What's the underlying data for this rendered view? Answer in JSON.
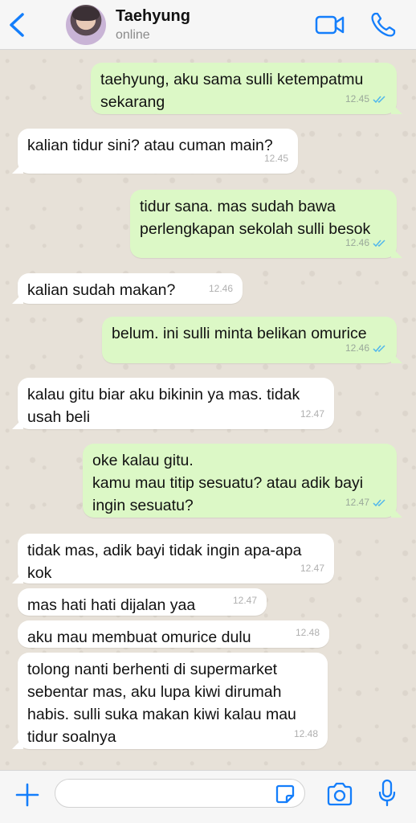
{
  "header": {
    "contact_name": "Taehyung",
    "status": "online",
    "icons": [
      "back-arrow-icon",
      "avatar",
      "video-call-icon",
      "phone-call-icon"
    ]
  },
  "messages": [
    {
      "direction": "out",
      "text": "taehyung, aku sama sulli ketempatmu\nsekarang",
      "time": "12.45",
      "read": true
    },
    {
      "direction": "in",
      "text": "kalian tidur sini? atau cuman main?",
      "time": "12.45"
    },
    {
      "direction": "out",
      "text": "tidur sana. mas sudah bawa\nperlengkapan sekolah sulli besok",
      "time": "12.46",
      "read": true
    },
    {
      "direction": "in",
      "text": "kalian sudah makan?",
      "time": "12.46"
    },
    {
      "direction": "out",
      "text": "belum. ini sulli minta belikan omurice",
      "time": "12.46",
      "read": true
    },
    {
      "direction": "in",
      "text": "kalau gitu biar aku bikinin ya mas. tidak\nusah beli",
      "time": "12.47"
    },
    {
      "direction": "out",
      "text": "oke kalau gitu.\nkamu mau titip sesuatu? atau adik bayi\ningin sesuatu?",
      "time": "12.47",
      "read": true
    },
    {
      "direction": "in",
      "text": "tidak mas, adik bayi tidak ingin apa-apa\nkok",
      "time": "12.47"
    },
    {
      "direction": "in",
      "text": "mas hati hati dijalan yaa",
      "time": "12.47"
    },
    {
      "direction": "in",
      "text": "aku mau membuat omurice dulu",
      "time": "12.48"
    },
    {
      "direction": "in",
      "text": "tolong nanti berhenti di supermarket\nsebentar mas, aku lupa kiwi dirumah\nhabis. sulli suka makan kiwi kalau mau\ntidur soalnya",
      "time": "12.48"
    }
  ],
  "composer": {
    "input_value": "",
    "icons": [
      "plus-icon",
      "sticker-icon",
      "camera-icon",
      "microphone-icon"
    ]
  },
  "colors": {
    "outgoing_bubble": "#dcf8c6",
    "incoming_bubble": "#ffffff",
    "accent_blue": "#147efb",
    "read_tick": "#4fb6ec",
    "chat_background": "#e7e1d8"
  }
}
